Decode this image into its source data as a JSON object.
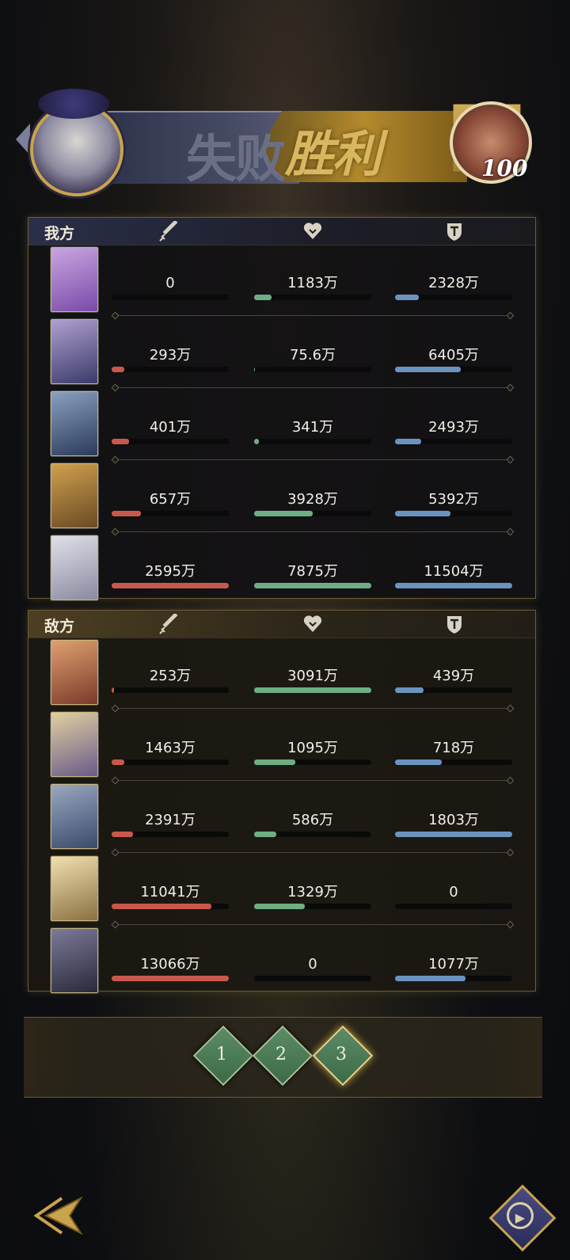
{
  "header": {
    "lose_label": "失败",
    "win_label": "胜利",
    "enemy_level": "100"
  },
  "columns": {
    "attack_icon": "sword-icon",
    "hp_icon": "heart-icon",
    "defense_icon": "shield-icon"
  },
  "ally": {
    "label": "我方",
    "rows": [
      {
        "atk": "0",
        "atk_pct": 0,
        "hp": "1183万",
        "hp_pct": 15,
        "def": "2328万",
        "def_pct": 20
      },
      {
        "atk": "293万",
        "atk_pct": 11,
        "hp": "75.6万",
        "hp_pct": 1,
        "def": "6405万",
        "def_pct": 56
      },
      {
        "atk": "401万",
        "atk_pct": 15,
        "hp": "341万",
        "hp_pct": 4,
        "def": "2493万",
        "def_pct": 22
      },
      {
        "atk": "657万",
        "atk_pct": 25,
        "hp": "3928万",
        "hp_pct": 50,
        "def": "5392万",
        "def_pct": 47
      },
      {
        "atk": "2595万",
        "atk_pct": 100,
        "hp": "7875万",
        "hp_pct": 100,
        "def": "11504万",
        "def_pct": 100
      }
    ]
  },
  "enemy": {
    "label": "敌方",
    "rows": [
      {
        "atk": "253万",
        "atk_pct": 2,
        "hp": "3091万",
        "hp_pct": 100,
        "def": "439万",
        "def_pct": 24
      },
      {
        "atk": "1463万",
        "atk_pct": 11,
        "hp": "1095万",
        "hp_pct": 35,
        "def": "718万",
        "def_pct": 40
      },
      {
        "atk": "2391万",
        "atk_pct": 18,
        "hp": "586万",
        "hp_pct": 19,
        "def": "1803万",
        "def_pct": 100
      },
      {
        "atk": "11041万",
        "atk_pct": 85,
        "hp": "1329万",
        "hp_pct": 43,
        "def": "0",
        "def_pct": 0
      },
      {
        "atk": "13066万",
        "atk_pct": 100,
        "hp": "0",
        "hp_pct": 0,
        "def": "1077万",
        "def_pct": 60
      }
    ]
  },
  "rounds": [
    "1",
    "2",
    "3"
  ],
  "active_round": "3",
  "colors": {
    "attack": "#c9584c",
    "hp": "#6fae84",
    "defense": "#6b93bf",
    "gold": "#c9a34e"
  }
}
